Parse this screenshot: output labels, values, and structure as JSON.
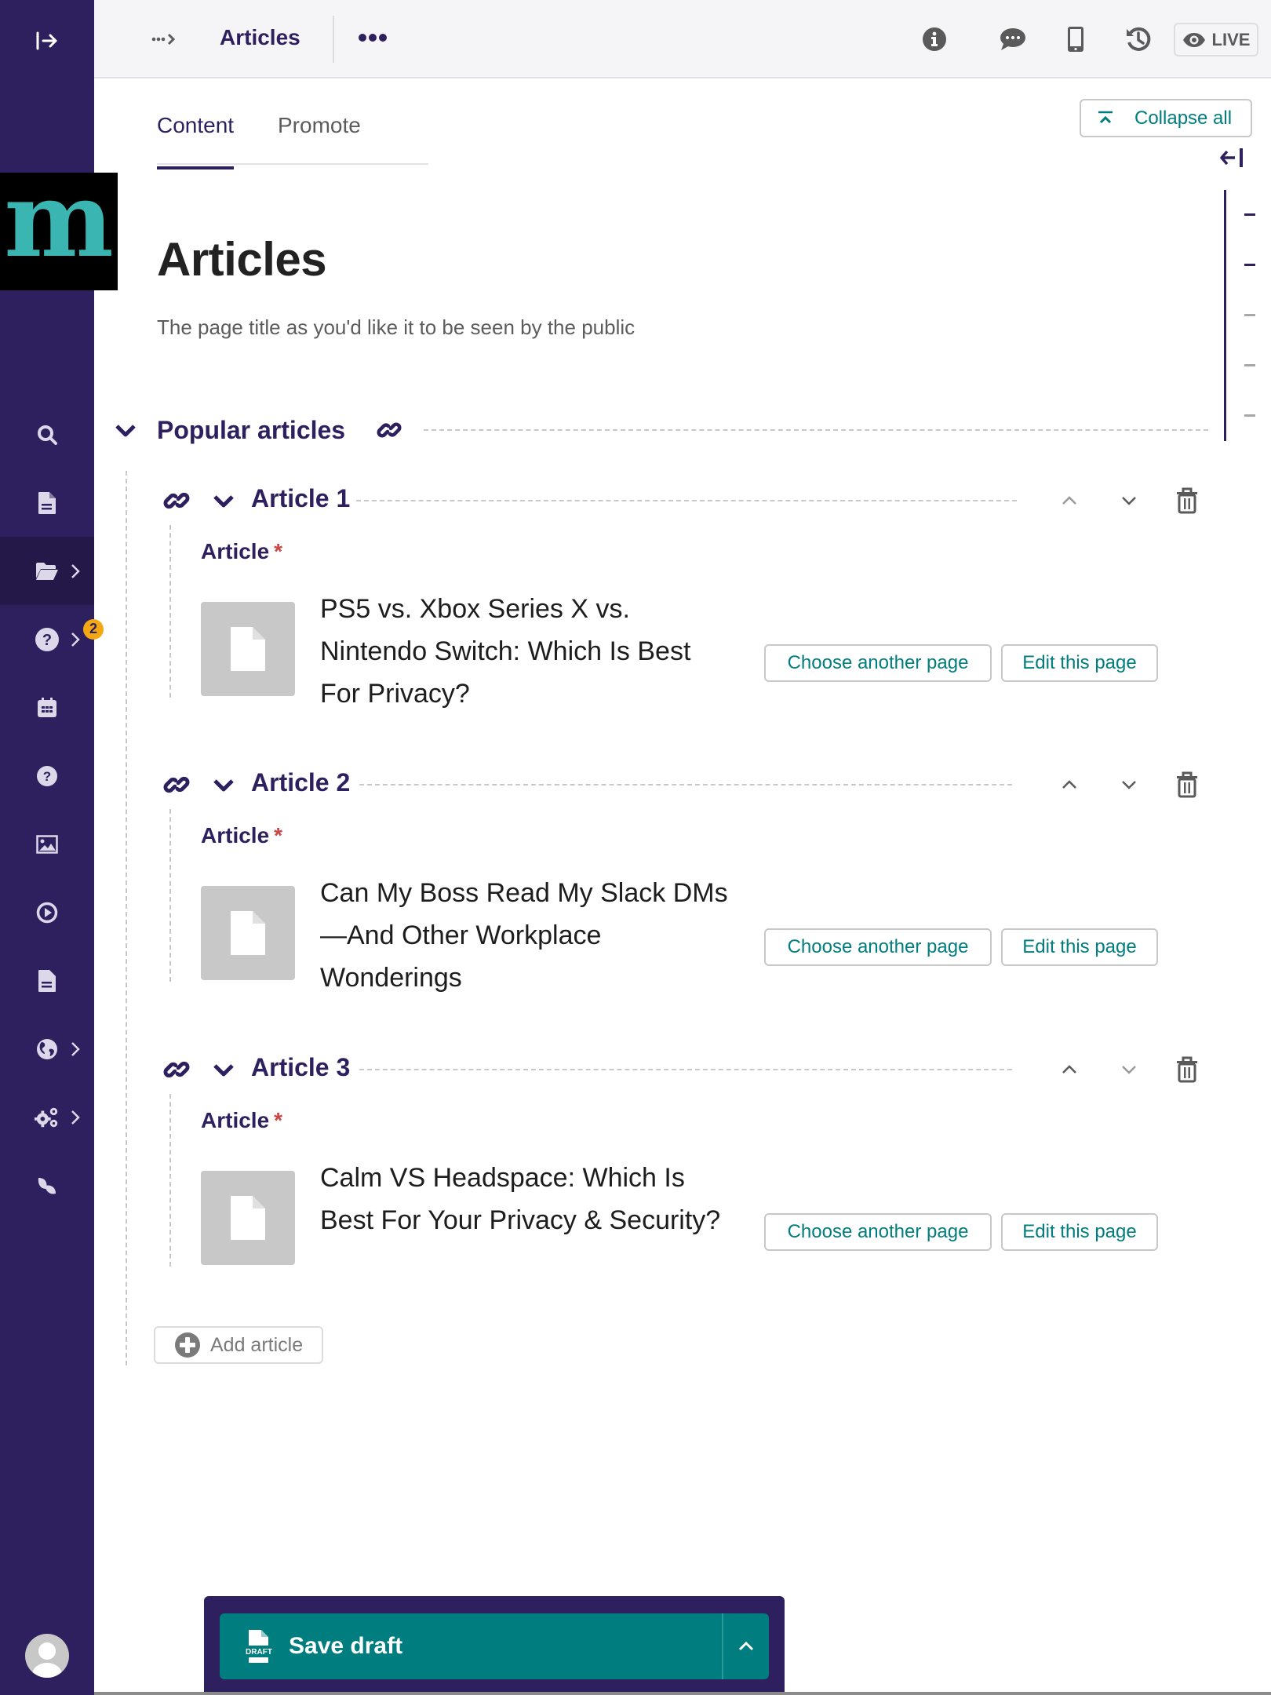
{
  "sidebar": {
    "toggle_icon": "expand-sidebar-icon",
    "logo_text": "m",
    "items": [
      {
        "icon": "search-icon",
        "label": "Search",
        "has_submenu": false
      },
      {
        "icon": "document-icon",
        "label": "Pages",
        "has_submenu": false
      },
      {
        "icon": "folder-open-icon",
        "label": "Explorer",
        "has_submenu": true,
        "active": true
      },
      {
        "icon": "help-icon",
        "label": "Help",
        "has_submenu": true,
        "badge": "2"
      },
      {
        "icon": "calendar-icon",
        "label": "Calendar",
        "has_submenu": false
      },
      {
        "icon": "question-icon",
        "label": "FAQ",
        "has_submenu": false
      },
      {
        "icon": "image-icon",
        "label": "Images",
        "has_submenu": false
      },
      {
        "icon": "media-play-icon",
        "label": "Media",
        "has_submenu": false
      },
      {
        "icon": "document-icon",
        "label": "Documents",
        "has_submenu": false
      },
      {
        "icon": "globe-icon",
        "label": "Sites",
        "has_submenu": true
      },
      {
        "icon": "cogs-icon",
        "label": "Settings",
        "has_submenu": true
      },
      {
        "icon": "leaf-icon",
        "label": "Wagtail",
        "has_submenu": false
      }
    ],
    "avatar_icon": "user-avatar-icon"
  },
  "header": {
    "breadcrumb_icon": "breadcrumb-expand-icon",
    "title": "Articles",
    "more_icon": "more-actions-icon",
    "icons": [
      "info-icon",
      "comment-icon",
      "mobile-preview-icon",
      "history-icon"
    ],
    "live_label": "LIVE"
  },
  "tabs": [
    {
      "label": "Content",
      "active": true
    },
    {
      "label": "Promote",
      "active": false
    }
  ],
  "collapse_all_label": "Collapse all",
  "page": {
    "title": "Articles",
    "help_text": "The page title as you'd like it to be seen by the public"
  },
  "section": {
    "title": "Popular articles"
  },
  "articles": [
    {
      "heading": "Article 1",
      "field_label": "Article",
      "required_mark": "*",
      "page_title": "PS5 vs. Xbox Series X vs. Nintendo Switch: Which Is Best For Privacy?",
      "choose_label": "Choose another page",
      "edit_label": "Edit this page",
      "move_up_disabled": true,
      "move_down_disabled": false
    },
    {
      "heading": "Article 2",
      "field_label": "Article",
      "required_mark": "*",
      "page_title": "Can My Boss Read My Slack DMs—And Other Workplace Wonderings",
      "choose_label": "Choose another page",
      "edit_label": "Edit this page",
      "move_up_disabled": false,
      "move_down_disabled": false
    },
    {
      "heading": "Article 3",
      "field_label": "Article",
      "required_mark": "*",
      "page_title": "Calm VS Headspace: Which Is Best For Your Privacy & Security?",
      "choose_label": "Choose another page",
      "edit_label": "Edit this page",
      "move_up_disabled": false,
      "move_down_disabled": true
    }
  ],
  "add_article_label": "Add article",
  "footer": {
    "save_label": "Save draft",
    "draft_icon_text": "DRAFT"
  },
  "colors": {
    "sidebar_bg": "#2e1f5e",
    "accent_teal": "#007d7e",
    "logo_teal": "#3bb5b2",
    "badge": "#f3a712",
    "required": "#cd4444"
  }
}
